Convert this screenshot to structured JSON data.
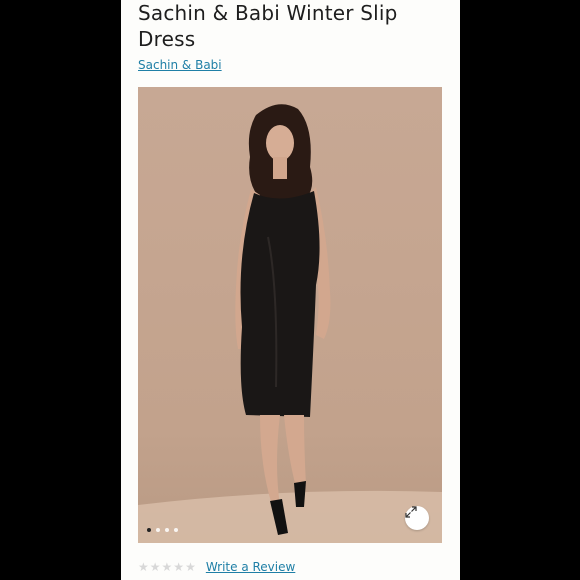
{
  "product": {
    "title": "Sachin & Babi Winter Slip Dress",
    "brand": "Sachin & Babi"
  },
  "gallery": {
    "image_count": 4,
    "active_index": 0,
    "expand_icon": "expand-arrows-icon"
  },
  "reviews": {
    "rating": 0,
    "max_stars": 5,
    "star_icon": "star-icon",
    "write_label": "Write a Review"
  },
  "colors": {
    "link": "#1f7fa6",
    "background": "#000000",
    "panel": "#fdfdfb"
  }
}
